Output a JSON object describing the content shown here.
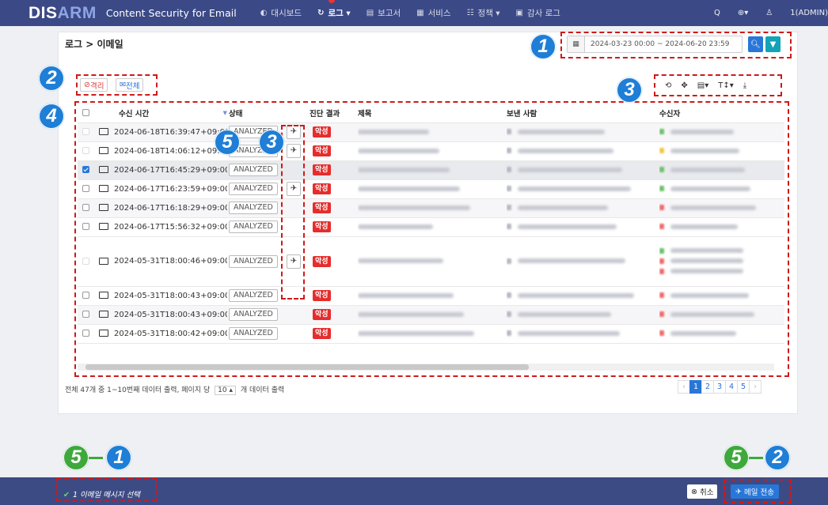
{
  "app": {
    "logo_a": "DIS",
    "logo_b": "ARM",
    "title": "Content Security for Email"
  },
  "menu": [
    {
      "icon": "◐",
      "label": "대시보드"
    },
    {
      "icon": "↻",
      "label": "로그 ▾"
    },
    {
      "icon": "▤",
      "label": "보고서"
    },
    {
      "icon": "▦",
      "label": "서비스"
    },
    {
      "icon": "☷",
      "label": "정책 ▾"
    },
    {
      "icon": "▣",
      "label": "감사 로그"
    }
  ],
  "rightnav": {
    "search": "Q",
    "globe": "⊕▾",
    "user": "1(ADMIN)"
  },
  "breadcrumb": "로그 > 이메일",
  "date_range": "2024-03-23 00:00 ~ 2024-06-20 23:59",
  "toolbar": {
    "quarantine": "격리",
    "all": "전체"
  },
  "tools": {
    "refresh": "⟲",
    "move": "✥",
    "columns": "▤▾",
    "text_size": "T↕▾",
    "download": "⤓"
  },
  "columns": {
    "recv_time": "수신 시간",
    "status": "상태",
    "result": "진단 결과",
    "subject": "제목",
    "sender": "보낸 사람",
    "recipient": "수신자"
  },
  "rows": [
    {
      "time": "2024-06-18T16:39:47+09:00",
      "status": "ANALYZED",
      "result": "악성"
    },
    {
      "time": "2024-06-18T14:06:12+09:00",
      "status": "ANALYZED",
      "result": "악성"
    },
    {
      "time": "2024-06-17T16:45:29+09:00",
      "status": "ANALYZED",
      "result": "악성"
    },
    {
      "time": "2024-06-17T16:23:59+09:00",
      "status": "ANALYZED",
      "result": "악성"
    },
    {
      "time": "2024-06-17T16:18:29+09:00",
      "status": "ANALYZED",
      "result": "악성"
    },
    {
      "time": "2024-06-17T15:56:32+09:00",
      "status": "ANALYZED",
      "result": "악성"
    },
    {
      "time": "2024-05-31T18:00:46+09:00",
      "status": "ANALYZED",
      "result": "악성"
    },
    {
      "time": "2024-05-31T18:00:43+09:00",
      "status": "ANALYZED",
      "result": "악성"
    },
    {
      "time": "2024-05-31T18:00:43+09:00",
      "status": "ANALYZED",
      "result": "악성"
    },
    {
      "time": "2024-05-31T18:00:42+09:00",
      "status": "ANALYZED",
      "result": "악성"
    }
  ],
  "footer": {
    "summary_a": "전체 47개 중 1~10번째 데이터 출력, 페이지 당",
    "per_page": "10 ▴",
    "summary_b": "개 데이터 출력"
  },
  "pager": [
    "‹",
    "1",
    "2",
    "3",
    "4",
    "5",
    "›"
  ],
  "bottom": {
    "selected": "1 이메일 메시지 선택",
    "cancel": "취소",
    "send": "메일 전송"
  },
  "callouts": [
    "1",
    "2",
    "3",
    "4",
    "5",
    "3",
    "5",
    "1",
    "5",
    "2"
  ]
}
